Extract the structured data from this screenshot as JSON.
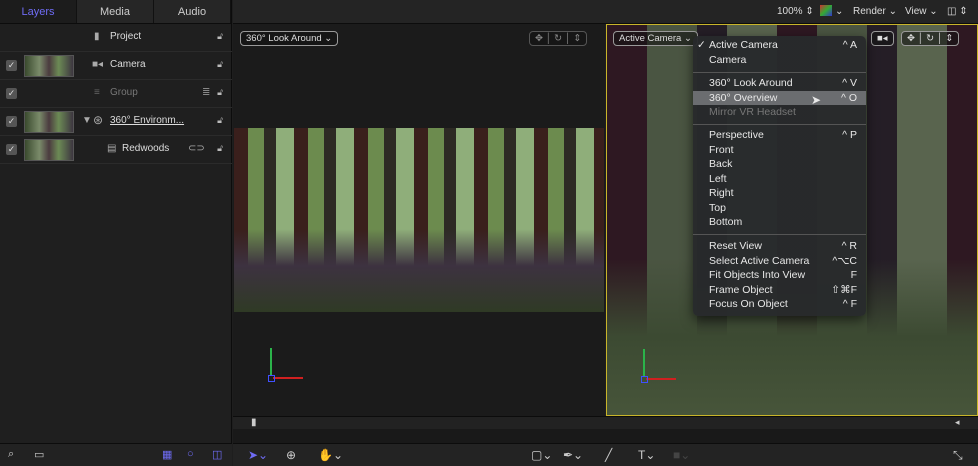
{
  "left_panel": {
    "tabs": [
      {
        "label": "Layers"
      },
      {
        "label": "Media"
      },
      {
        "label": "Audio"
      }
    ],
    "layers": [
      {
        "name": "Project"
      },
      {
        "name": "Camera"
      },
      {
        "name": "Group"
      },
      {
        "name": "360° Environm..."
      },
      {
        "name": "Redwoods"
      }
    ]
  },
  "topbar": {
    "zoom": "100%",
    "render": "Render",
    "view": "View"
  },
  "left_viewer": {
    "camera_menu": "360° Look Around"
  },
  "right_viewer": {
    "camera_menu": "Active Camera"
  },
  "camera_menu": {
    "items": [
      {
        "label": "Active Camera",
        "shortcut": "^ A",
        "checked": "✓"
      },
      {
        "label": "Camera",
        "shortcut": ""
      },
      {
        "label": "360° Look Around",
        "shortcut": "^ V"
      },
      {
        "label": "360° Overview",
        "shortcut": "^ O"
      },
      {
        "label": "Mirror VR Headset",
        "shortcut": ""
      },
      {
        "label": "Perspective",
        "shortcut": "^ P"
      },
      {
        "label": "Front",
        "shortcut": ""
      },
      {
        "label": "Back",
        "shortcut": ""
      },
      {
        "label": "Left",
        "shortcut": ""
      },
      {
        "label": "Right",
        "shortcut": ""
      },
      {
        "label": "Top",
        "shortcut": ""
      },
      {
        "label": "Bottom",
        "shortcut": ""
      },
      {
        "label": "Reset View",
        "shortcut": "^ R"
      },
      {
        "label": "Select Active Camera",
        "shortcut": "^⌥C"
      },
      {
        "label": "Fit Objects Into View",
        "shortcut": "F"
      },
      {
        "label": "Frame Object",
        "shortcut": "⇧⌘F"
      },
      {
        "label": "Focus On Object",
        "shortcut": "^ F"
      }
    ]
  },
  "colors": {
    "accent": "#6f6cf5",
    "selection_border": "#c9b52a"
  }
}
